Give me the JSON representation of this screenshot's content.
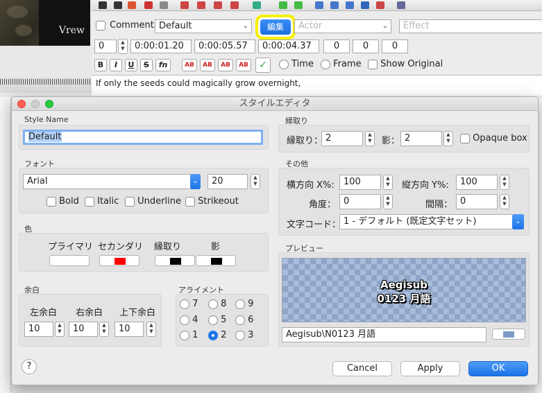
{
  "video": {
    "label": "Vrew"
  },
  "editor": {
    "comment_label": "Comment",
    "style_value": "Default",
    "edit_button": "編集",
    "actor_placeholder": "Actor",
    "effect_placeholder": "Effect",
    "layer": "0",
    "start_time": "0:00:01.20",
    "end_time": "0:00:05.57",
    "duration": "0:00:04.37",
    "margin_l": "0",
    "margin_r": "0",
    "margin_v": "0",
    "format_buttons": [
      "B",
      "I",
      "U",
      "S",
      "fn",
      "AB",
      "AB",
      "AB",
      "AB"
    ],
    "time_label": "Time",
    "frame_label": "Frame",
    "show_original_label": "Show Original",
    "subtitle_text": "If only the seeds could magically grow overnight,"
  },
  "dialog": {
    "title": "スタイルエディタ",
    "style_name_label": "Style Name",
    "style_name_value": "Default",
    "font_label": "フォント",
    "font_value": "Arial",
    "font_size": "20",
    "bold_label": "Bold",
    "italic_label": "Italic",
    "underline_label": "Underline",
    "strikeout_label": "Strikeout",
    "colors_label": "色",
    "primary_label": "プライマリ",
    "secondary_label": "セカンダリ",
    "outline_label": "縁取り",
    "shadow_label": "影",
    "colors": {
      "primary": "#ffffff",
      "secondary": "#ff0000",
      "outline": "#000000",
      "shadow": "#000000"
    },
    "margins_label": "余白",
    "margin_left_label": "左余白",
    "margin_right_label": "右余白",
    "margin_vert_label": "上下余白",
    "margin_left": "10",
    "margin_right": "10",
    "margin_vert": "10",
    "alignment_label": "アライメント",
    "alignment_options": [
      "7",
      "8",
      "9",
      "4",
      "5",
      "6",
      "1",
      "2",
      "3"
    ],
    "alignment_selected": "2",
    "border_group_label": "縁取り",
    "border_label": "縁取り：",
    "border_value": "2",
    "shadow_field_label": "影：",
    "shadow_value": "2",
    "opaque_box_label": "Opaque box",
    "misc_label": "その他",
    "scale_x_label": "横方向 X%:",
    "scale_x": "100",
    "scale_y_label": "縦方向 Y%:",
    "scale_y": "100",
    "angle_label": "角度：",
    "angle": "0",
    "spacing_label": "間隔：",
    "spacing": "0",
    "encoding_label": "文字コード：",
    "encoding_value": "1 - デフォルト (既定文字セット)",
    "preview_label": "プレビュー",
    "preview_line1": "Aegisub",
    "preview_line2": "0123 月語",
    "preview_text": "Aegisub\\N0123 月語",
    "cancel": "Cancel",
    "apply": "Apply",
    "ok": "OK",
    "help": "?"
  }
}
